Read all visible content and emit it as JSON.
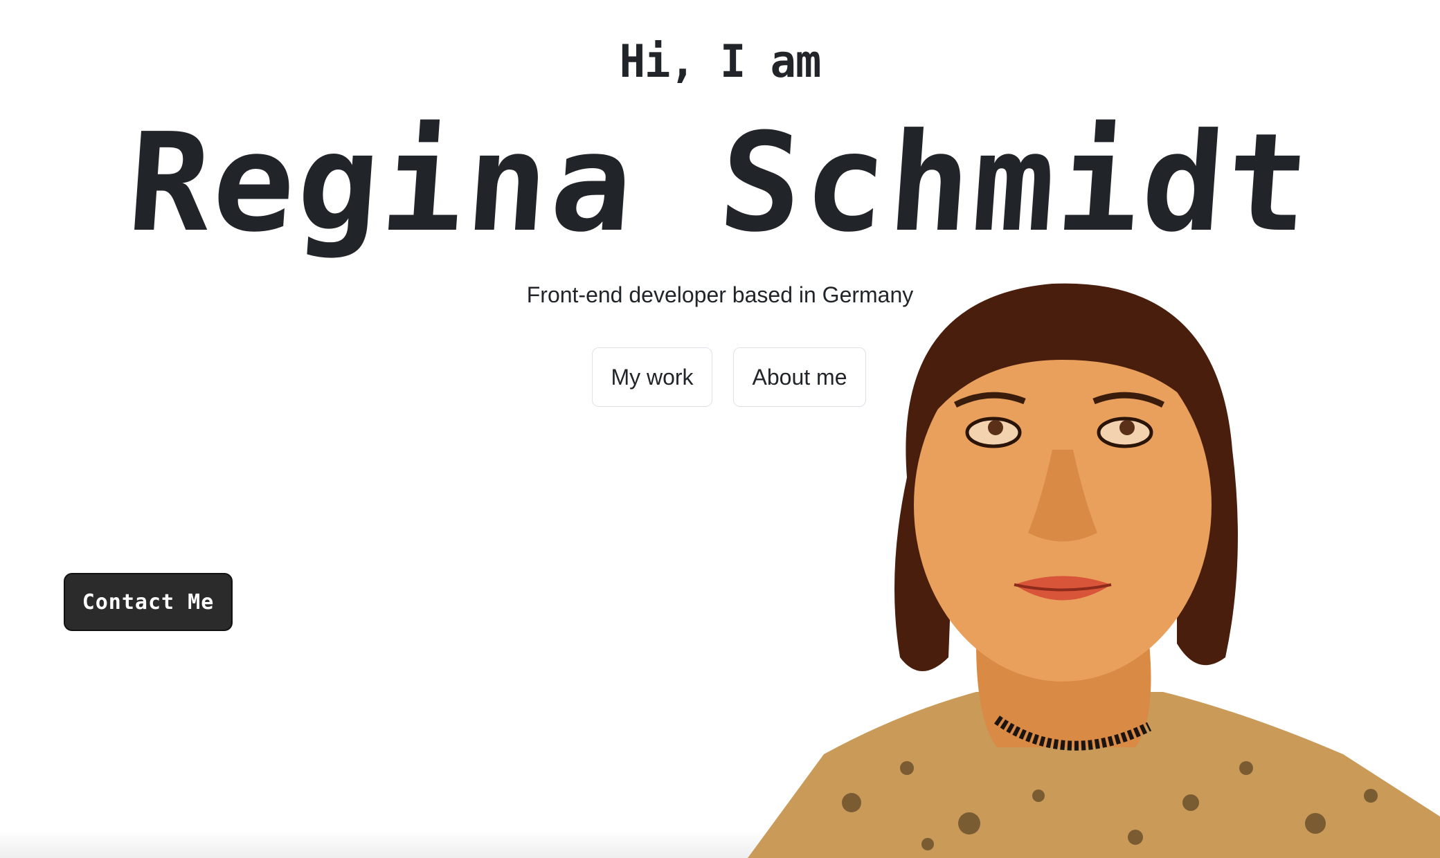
{
  "hero": {
    "greeting": "Hi, I am",
    "name": "Regina Schmidt",
    "subtitle": "Front-end developer based in Germany"
  },
  "buttons": {
    "my_work": "My work",
    "about_me": "About me",
    "contact": "Contact Me"
  },
  "portrait": {
    "alt": "illustrated portrait of Regina Schmidt"
  },
  "colors": {
    "text": "#212529",
    "contact_bg": "#2b2b2b",
    "outline_border": "#dee2e6",
    "hair": "#4a1e0c",
    "skin": "#e9a05c"
  }
}
